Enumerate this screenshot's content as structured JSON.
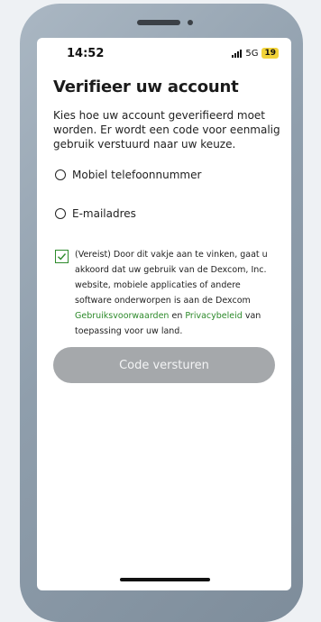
{
  "status_bar": {
    "time": "14:52",
    "network": "5G",
    "battery": "19"
  },
  "page": {
    "title": "Verifieer uw account",
    "intro": "Kies hoe uw account geverifieerd moet worden. Er wordt een code voor eenmalig gebruik verstuurd naar uw keuze."
  },
  "options": {
    "phone_label": "Mobiel telefoonnummer",
    "email_label": "E-mailadres"
  },
  "consent": {
    "checked": true,
    "text_before": "(Vereist) Door dit vakje aan te vinken, gaat u akkoord dat uw gebruik van de Dexcom, Inc. website, mobiele applicaties of andere software onderworpen is aan de Dexcom ",
    "terms_link": "Gebruiksvoorwaarden",
    "connector": " en ",
    "privacy_link": "Privacybeleid",
    "text_after": " van toepassing voor uw land."
  },
  "actions": {
    "submit_label": "Code versturen"
  },
  "colors": {
    "accent_green": "#2d8a2b",
    "button_disabled": "#a5a8ab",
    "battery_yellow": "#f2d33a",
    "phone_frame": "#8f9eac"
  }
}
